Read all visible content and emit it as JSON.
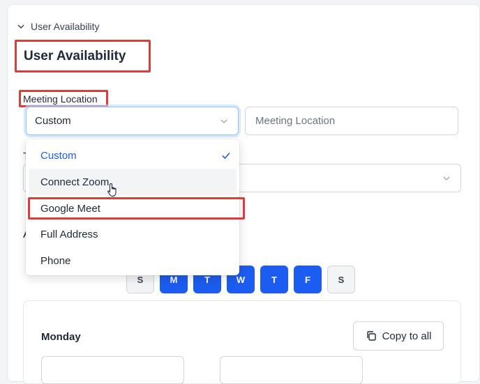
{
  "section": {
    "collapse_label": "User Availability",
    "title": "User Availability"
  },
  "meeting_location": {
    "label": "Meeting Location",
    "selected": "Custom",
    "input_placeholder": "Meeting Location",
    "options": [
      "Custom",
      "Connect Zoom",
      "Google Meet",
      "Full Address",
      "Phone"
    ]
  },
  "partial_labels": {
    "timezone_letter": "T",
    "availability_letter": "A"
  },
  "days": [
    {
      "label": "S",
      "active": false
    },
    {
      "label": "M",
      "active": true
    },
    {
      "label": "T",
      "active": true
    },
    {
      "label": "W",
      "active": true
    },
    {
      "label": "T",
      "active": true
    },
    {
      "label": "F",
      "active": true
    },
    {
      "label": "S",
      "active": false
    }
  ],
  "schedule": {
    "day_name": "Monday",
    "copy_label": "Copy to all"
  },
  "colors": {
    "accent": "#1d5cf0",
    "highlight": "#dc3c3c",
    "hover_bg": "#f3f4f6"
  }
}
